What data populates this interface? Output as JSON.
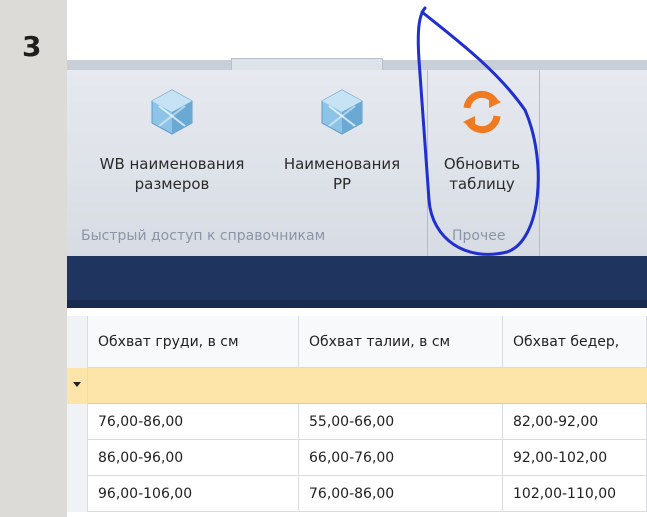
{
  "slide_number": "3",
  "ribbon": {
    "buttons": [
      {
        "label_line1": "WB наименования",
        "label_line2": "размеров",
        "icon": "cube-icon"
      },
      {
        "label_line1": "Наименования",
        "label_line2": "РР",
        "icon": "cube-icon"
      },
      {
        "label_line1": "Обновить",
        "label_line2": "таблицу",
        "icon": "refresh-icon"
      }
    ],
    "groups": [
      {
        "label": "Быстрый доступ к справочникам"
      },
      {
        "label": "Прочее"
      }
    ]
  },
  "grid": {
    "columns": [
      "Обхват груди, в см",
      "Обхват талии, в см",
      "Обхват бедер,"
    ],
    "rows": [
      [
        "76,00-86,00",
        "55,00-66,00",
        "82,00-92,00"
      ],
      [
        "86,00-96,00",
        "66,00-76,00",
        "92,00-102,00"
      ],
      [
        "96,00-106,00",
        "76,00-86,00",
        "102,00-110,00"
      ]
    ]
  },
  "colors": {
    "ribbon": "#dee3ea",
    "navy_bar": "#1f3560",
    "filter_row": "#fde4a8",
    "annotation": "#1f2fd0",
    "refresh_icon": "#f07a20",
    "cube_icon": "#7ab8e0"
  }
}
